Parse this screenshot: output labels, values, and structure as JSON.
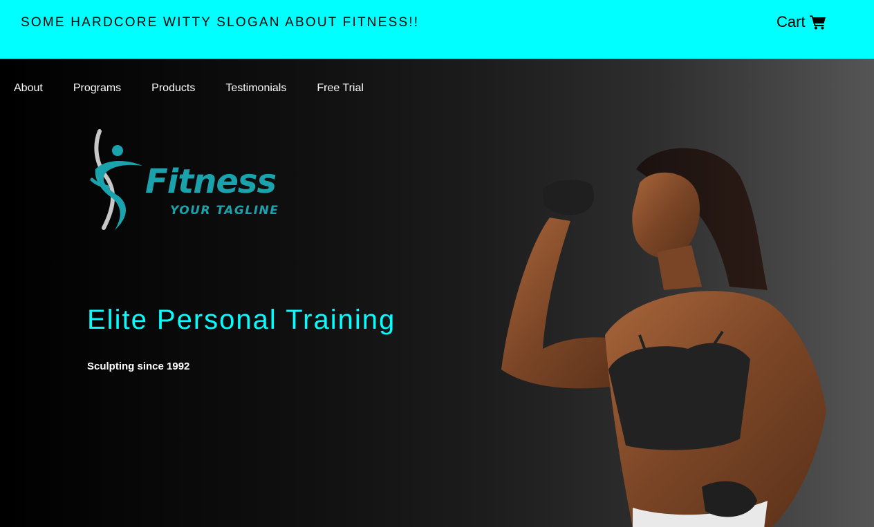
{
  "header": {
    "slogan": "SOME HARDCORE WITTY SLOGAN ABOUT FITNESS!!",
    "cart_label": "Cart",
    "cart_icon": "shopping-cart-icon",
    "background_color": "#00ffff"
  },
  "nav": {
    "items": [
      {
        "label": "About"
      },
      {
        "label": "Programs"
      },
      {
        "label": "Products"
      },
      {
        "label": "Testimonials"
      },
      {
        "label": "Free Trial"
      }
    ]
  },
  "hero": {
    "logo": {
      "brand": "Fitness",
      "tagline": "YOUR TAGLINE",
      "color": "#1aa3ad"
    },
    "headline": "Elite Personal Training",
    "subline": "Sculpting since 1992",
    "accent_color": "#00ffff"
  }
}
